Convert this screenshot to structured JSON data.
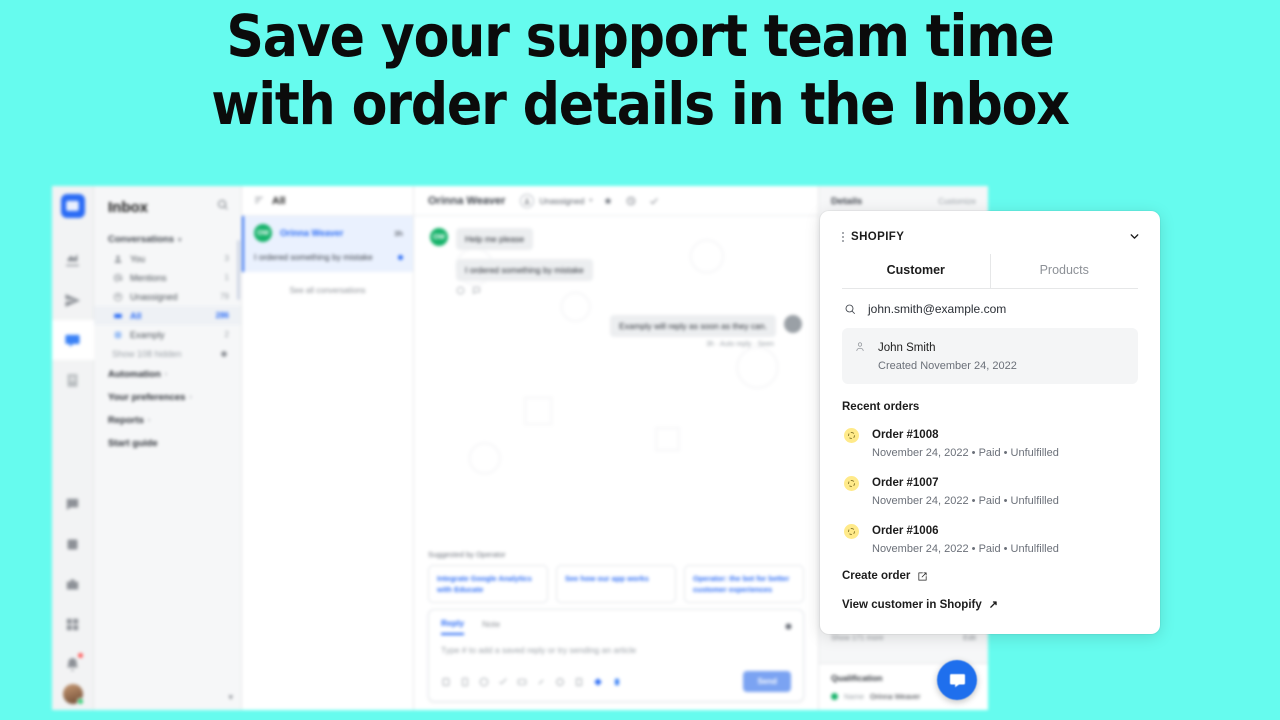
{
  "page": {
    "background_color": "#66FBEE",
    "headline_line1": "Save your support team time",
    "headline_line2": "with order details in the Inbox"
  },
  "rail": {
    "logo_icon": "intercom-logo-icon",
    "items": [
      {
        "icon": "reports-icon",
        "label": "Reports"
      },
      {
        "icon": "outbound-icon",
        "label": "Outbound"
      },
      {
        "icon": "inbox-icon",
        "label": "Inbox",
        "active": true
      },
      {
        "icon": "articles-icon",
        "label": "Articles"
      },
      {
        "icon": "messenger-icon",
        "label": "Messenger"
      },
      {
        "icon": "apps-icon",
        "label": "Apps"
      },
      {
        "icon": "briefcase-icon",
        "label": "Workspace"
      },
      {
        "icon": "grid-icon",
        "label": "More"
      },
      {
        "icon": "bell-icon",
        "label": "Notifications",
        "badge": true
      }
    ],
    "avatar": "user-avatar"
  },
  "nav": {
    "title": "Inbox",
    "search_icon": "search-icon",
    "group_label": "Conversations",
    "items": [
      {
        "icon": "person-icon",
        "label": "You",
        "count": "3"
      },
      {
        "icon": "mention-icon",
        "label": "Mentions",
        "count": "1"
      },
      {
        "icon": "unassigned-icon",
        "label": "Unassigned",
        "count": "79"
      },
      {
        "icon": "inbox-all-icon",
        "label": "All",
        "count": "286",
        "selected": true
      },
      {
        "icon": "team-icon",
        "label": "Examply",
        "count": "2"
      }
    ],
    "hidden_label": "Show 108 hidden",
    "hidden_icon": "gear-icon",
    "links": [
      {
        "label": "Automation",
        "chevron": "›"
      },
      {
        "label": "Your preferences",
        "chevron": "›"
      },
      {
        "label": "Reports",
        "chevron": "›"
      },
      {
        "label": "Start guide",
        "chevron": ""
      }
    ]
  },
  "conversation_list": {
    "filter_icon": "sort-icon",
    "header": "All",
    "selected": {
      "avatar_initials": "OW",
      "name": "Orinna Weaver",
      "time": "3h",
      "preview": "I ordered something by mistake",
      "unread": true
    },
    "see_all": "See all conversations"
  },
  "conversation": {
    "name": "Orinna Weaver",
    "assignee_label": "Unassigned",
    "assignee_caret": "▾",
    "header_icons": [
      "star-icon",
      "snooze-icon",
      "close-check-icon"
    ],
    "messages": [
      {
        "from": "customer",
        "avatar_initials": "OW",
        "text": "Help me please"
      },
      {
        "from": "customer",
        "text": "I ordered something by mistake"
      },
      {
        "from": "agent",
        "text": "Examply will reply as soon as they can.",
        "meta": "3h · Auto reply · Seen"
      }
    ],
    "reaction_icons": [
      "emoji-icon",
      "reply-icon"
    ]
  },
  "suggested": {
    "label": "Suggested by Operator",
    "chips": [
      "Integrate Google Analytics with Educate",
      "See how our app works",
      "Operator: the bot for better customer experiences"
    ]
  },
  "composer": {
    "tabs": [
      {
        "label": "Reply",
        "active": true
      },
      {
        "label": "Note",
        "active": false
      }
    ],
    "gear_icon": "gear-icon",
    "placeholder": "Type # to add a saved reply or try sending an article",
    "tool_icons": [
      "saved-reply-icon",
      "article-icon",
      "emoji-icon",
      "checklist-icon",
      "image-icon",
      "attachment-icon",
      "gif-icon",
      "bold-icon",
      "tag-icon",
      "apps-icon"
    ],
    "send_label": "Send",
    "send_color": "#7BA3F2"
  },
  "details_panel": {
    "title": "Details",
    "customize_label": "Customize",
    "show_more": "Show 171 more",
    "edit_label": "Edit",
    "qualification_title": "Qualification",
    "qualification_rows": [
      {
        "key": "Name",
        "value": "Orinna Weaver"
      }
    ]
  },
  "shopify": {
    "grip_icon": "drag-handle-icon",
    "title": "SHOPIFY",
    "collapse_icon": "chevron-down-icon",
    "tabs": [
      {
        "label": "Customer",
        "active": true
      },
      {
        "label": "Products",
        "active": false
      }
    ],
    "search": {
      "icon": "search-icon",
      "value": "john.smith@example.com"
    },
    "customer": {
      "icon": "person-icon",
      "name": "John Smith",
      "created": "Created November 24, 2022"
    },
    "recent_orders_label": "Recent orders",
    "orders": [
      {
        "status_icon": "unfulfilled-icon",
        "number": "Order #1008",
        "meta": "November 24, 2022 • Paid • Unfulfilled"
      },
      {
        "status_icon": "unfulfilled-icon",
        "number": "Order #1007",
        "meta": "November 24, 2022 • Paid • Unfulfilled"
      },
      {
        "status_icon": "unfulfilled-icon",
        "number": "Order #1006",
        "meta": "November 24, 2022 • Paid • Unfulfilled"
      }
    ],
    "actions": [
      {
        "label": "Create order",
        "icon": "external-edit-icon",
        "arrow": ""
      },
      {
        "label": "View customer in Shopify",
        "icon": "",
        "arrow": "↗"
      }
    ],
    "status_badge_color": "#FFEA8A"
  },
  "launcher": {
    "icon": "messenger-icon",
    "color": "#1F6FED"
  }
}
